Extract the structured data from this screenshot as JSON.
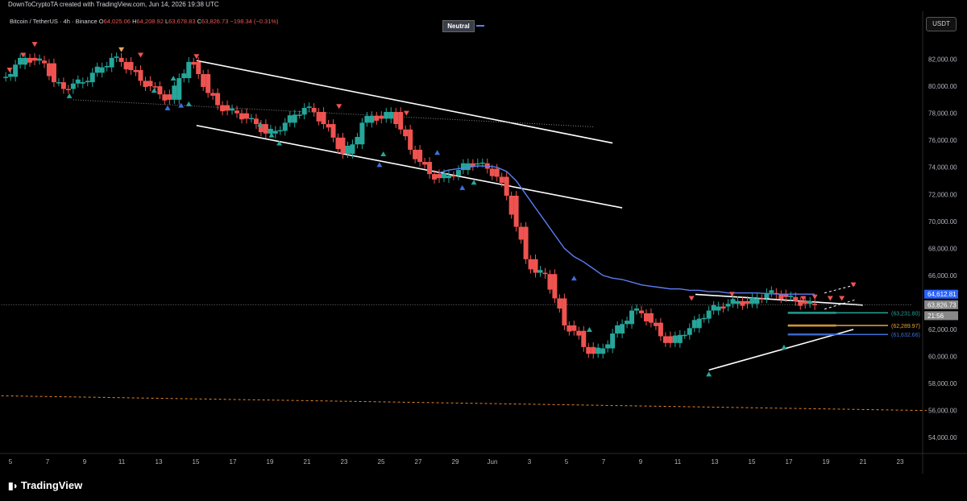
{
  "header": {
    "caption": "DownToCryptoTA created with TradingView.com, Jun 14, 2026 19:38 UTC"
  },
  "symbol": {
    "title": "Bitcoin / TetherUS · 4h · Binance",
    "open_label": "O",
    "open": "64,025.06",
    "high_label": "H",
    "high": "64,208.92",
    "low_label": "L",
    "low": "63,678.83",
    "close_label": "C",
    "close": "63,826.73",
    "change": "−198.34 (−0.31%)"
  },
  "indicator": {
    "label": "Neutral",
    "color": "#5b7ef5"
  },
  "currency_button": "USDT",
  "brand": {
    "name": "TradingView"
  },
  "colors": {
    "up": "#26a69a",
    "down": "#ef5350",
    "ma": "#5b7ef5",
    "trend": "#ffffff"
  },
  "chart_data": {
    "type": "line",
    "ylim": [
      53000,
      84000
    ],
    "y_ticks": [
      "82,000.00",
      "80,000.00",
      "78,000.00",
      "76,000.00",
      "74,000.00",
      "72,000.00",
      "70,000.00",
      "68,000.00",
      "66,000.00",
      "62,000.00",
      "60,000.00",
      "58,000.00",
      "56,000.00",
      "54,000.00"
    ],
    "x_ticks": [
      "5",
      "7",
      "9",
      "11",
      "13",
      "15",
      "17",
      "19",
      "21",
      "23",
      "25",
      "27",
      "29",
      "Jun",
      "3",
      "5",
      "7",
      "9",
      "11",
      "13",
      "15",
      "17",
      "19",
      "21",
      "23"
    ],
    "price_series": {
      "name": "BTCUSDT 4h",
      "x": [
        5,
        5.5,
        6,
        6.5,
        7,
        7.5,
        8,
        8.5,
        9,
        9.5,
        10,
        10.5,
        11,
        11.5,
        12,
        12.5,
        13,
        13.5,
        14,
        14.5,
        15,
        15.5,
        16,
        16.5,
        17,
        17.5,
        18,
        18.5,
        19,
        19.5,
        20,
        20.5,
        21,
        21.5,
        22,
        22.5,
        23,
        23.5,
        24,
        24.5,
        25,
        25.5,
        26,
        26.5,
        27,
        27.5,
        28,
        28.5,
        29,
        29.5,
        30,
        30.5,
        31,
        31.5,
        32,
        32.5,
        33,
        33.5,
        34,
        34.5,
        35,
        35.5,
        36,
        36.5,
        37,
        37.5,
        38,
        38.5,
        39,
        39.5,
        40,
        40.5,
        41,
        41.5,
        42,
        42.5,
        43,
        43.5,
        44,
        44.5,
        45,
        45.5,
        46,
        46.5,
        47
      ],
      "y": [
        80700,
        81600,
        82100,
        81900,
        81700,
        80300,
        79800,
        80200,
        80300,
        81000,
        81400,
        82100,
        81800,
        81200,
        80400,
        80000,
        79400,
        79000,
        80600,
        81800,
        80900,
        79500,
        78600,
        78200,
        78000,
        77600,
        77200,
        76500,
        76700,
        77300,
        77900,
        78400,
        78100,
        77200,
        76200,
        75000,
        75700,
        77300,
        77800,
        77600,
        78100,
        76800,
        75300,
        74400,
        73500,
        73200,
        73400,
        73800,
        74300,
        74300,
        73900,
        73300,
        71900,
        69600,
        67200,
        66200,
        66100,
        64300,
        62300,
        61900,
        60700,
        60200,
        60600,
        61700,
        62400,
        63400,
        63200,
        62500,
        61500,
        61000,
        61600,
        62100,
        62800,
        63400,
        63700,
        63900,
        64100,
        63900,
        64300,
        64700,
        64600,
        64400,
        64100,
        63900,
        63800
      ]
    },
    "ma_series": {
      "name": "MA",
      "x": [
        27.5,
        28,
        28.5,
        29,
        29.5,
        30,
        30.5,
        31,
        31.5,
        32,
        32.5,
        33,
        33.5,
        34,
        34.5,
        35,
        35.5,
        36,
        36.5,
        37,
        37.5,
        38,
        38.5,
        39,
        39.5,
        40,
        40.5,
        41,
        41.5,
        42,
        42.5,
        43,
        43.5,
        44,
        44.5,
        45,
        45.5,
        46,
        46.5,
        47
      ],
      "y": [
        73600,
        73800,
        73900,
        74000,
        74100,
        74100,
        74000,
        73700,
        73000,
        72000,
        71000,
        70000,
        69000,
        68000,
        67400,
        67000,
        66500,
        66000,
        65800,
        65700,
        65500,
        65300,
        65200,
        65100,
        65000,
        65000,
        64900,
        64900,
        64800,
        64800,
        64700,
        64700,
        64700,
        64700,
        64650,
        64620,
        64612,
        64612,
        64612,
        64612
      ]
    },
    "trendlines": [
      {
        "name": "channel-upper",
        "x": [
          14.9,
          36.5
        ],
        "y": [
          81900,
          75800
        ]
      },
      {
        "name": "channel-lower",
        "x": [
          14.9,
          37
        ],
        "y": [
          77100,
          71000
        ]
      },
      {
        "name": "dotted-resistance",
        "x": [
          8.5,
          35.5
        ],
        "y": [
          79000,
          77000
        ],
        "style": "dotted"
      },
      {
        "name": "triangle-upper",
        "x": [
          40.8,
          49.5
        ],
        "y": [
          64600,
          63800
        ]
      },
      {
        "name": "triangle-lower",
        "x": [
          41.5,
          49
        ],
        "y": [
          59000,
          62000
        ]
      },
      {
        "name": "wedge-upper",
        "x": [
          47.5,
          49.1
        ],
        "y": [
          64700,
          65300
        ],
        "style": "dashed"
      },
      {
        "name": "wedge-lower",
        "x": [
          47.5,
          49.1
        ],
        "y": [
          63500,
          64200
        ],
        "style": "dashed"
      },
      {
        "name": "support-orange",
        "x": [
          0,
          52.8
        ],
        "y": [
          57200,
          56000
        ],
        "style": "dashed",
        "color": "#e8872a"
      },
      {
        "name": "current-price",
        "x": [
          0,
          52
        ],
        "y": [
          63826.73,
          63826.73
        ],
        "style": "dotted",
        "color": "#777"
      }
    ],
    "levels": [
      {
        "label": "(63,231.80)",
        "value": 63231.8,
        "color": "#26a69a",
        "x_start": 45.6
      },
      {
        "label": "(62,289.97)",
        "value": 62289.97,
        "color": "#e8a33a",
        "x_start": 45.6
      },
      {
        "label": "(61,632.66)",
        "value": 61632.66,
        "color": "#3f6fd6",
        "x_start": 45.6
      }
    ],
    "price_tags": [
      {
        "label": "64,612.81",
        "value": 64612.81,
        "bg": "#2962ff"
      },
      {
        "label": "63,826.73",
        "value": 63826.73,
        "bg": "#888888"
      },
      {
        "label": "21:56",
        "value": 63500,
        "bg": "#888888"
      }
    ],
    "markers": [
      {
        "x": 5.9,
        "y": 82300,
        "kind": "down",
        "color": "#ef5350"
      },
      {
        "x": 6.5,
        "y": 83100,
        "kind": "down",
        "color": "#ef5350"
      },
      {
        "x": 5.2,
        "y": 81200,
        "kind": "down",
        "color": "#ef5350"
      },
      {
        "x": 11,
        "y": 82700,
        "kind": "down",
        "color": "#f5a45a"
      },
      {
        "x": 12,
        "y": 82300,
        "kind": "down",
        "color": "#ef5350"
      },
      {
        "x": 14.9,
        "y": 82200,
        "kind": "down",
        "color": "#ef5350"
      },
      {
        "x": 22.3,
        "y": 78500,
        "kind": "down",
        "color": "#ef5350"
      },
      {
        "x": 25.8,
        "y": 78000,
        "kind": "down",
        "color": "#ef5350"
      },
      {
        "x": 8.3,
        "y": 79300,
        "kind": "up",
        "color": "#26a69a"
      },
      {
        "x": 12.7,
        "y": 79700,
        "kind": "up",
        "color": "#26a69a"
      },
      {
        "x": 13.7,
        "y": 80600,
        "kind": "up",
        "color": "#26a69a"
      },
      {
        "x": 14.5,
        "y": 78700,
        "kind": "up",
        "color": "#26a69a"
      },
      {
        "x": 18.2,
        "y": 77200,
        "kind": "up",
        "color": "#26a69a"
      },
      {
        "x": 18.8,
        "y": 76400,
        "kind": "up",
        "color": "#26a69a"
      },
      {
        "x": 19.2,
        "y": 75800,
        "kind": "up",
        "color": "#26a69a"
      },
      {
        "x": 24.6,
        "y": 75000,
        "kind": "up",
        "color": "#26a69a"
      },
      {
        "x": 29.3,
        "y": 72900,
        "kind": "up",
        "color": "#26a69a"
      },
      {
        "x": 13.4,
        "y": 78400,
        "kind": "up",
        "color": "#3f6fd6"
      },
      {
        "x": 14.1,
        "y": 78600,
        "kind": "up",
        "color": "#3f6fd6"
      },
      {
        "x": 24.4,
        "y": 74200,
        "kind": "up",
        "color": "#3f6fd6"
      },
      {
        "x": 27.4,
        "y": 75100,
        "kind": "up",
        "color": "#3f6fd6"
      },
      {
        "x": 28.7,
        "y": 72500,
        "kind": "up",
        "color": "#3f6fd6"
      },
      {
        "x": 34.5,
        "y": 65800,
        "kind": "up",
        "color": "#3f6fd6"
      },
      {
        "x": 35.3,
        "y": 62000,
        "kind": "up",
        "color": "#26a69a"
      },
      {
        "x": 41.5,
        "y": 58700,
        "kind": "up",
        "color": "#26a69a"
      },
      {
        "x": 45.4,
        "y": 60700,
        "kind": "up",
        "color": "#26a69a"
      },
      {
        "x": 40.6,
        "y": 64300,
        "kind": "down",
        "color": "#ef5350"
      },
      {
        "x": 42.7,
        "y": 64600,
        "kind": "down",
        "color": "#ef5350"
      },
      {
        "x": 46.4,
        "y": 64300,
        "kind": "down",
        "color": "#ef5350"
      },
      {
        "x": 47.0,
        "y": 64400,
        "kind": "down",
        "color": "#ef5350"
      },
      {
        "x": 47.8,
        "y": 64300,
        "kind": "down",
        "color": "#ef5350"
      },
      {
        "x": 48.4,
        "y": 64300,
        "kind": "down",
        "color": "#ef5350"
      },
      {
        "x": 49.0,
        "y": 65300,
        "kind": "down",
        "color": "#ef5350"
      }
    ]
  }
}
